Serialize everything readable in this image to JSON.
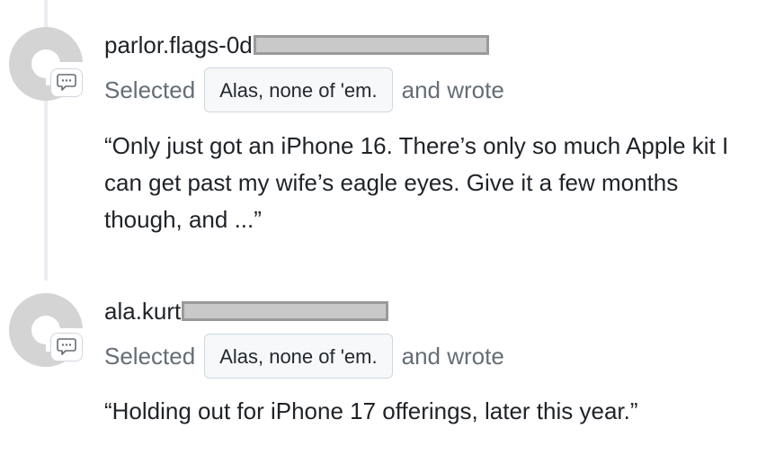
{
  "comments": [
    {
      "username": "parlor.flags-0d",
      "selected_label": "Selected",
      "choice": "Alas, none of 'em.",
      "wrote_label": "and wrote",
      "body": "“Only just got an iPhone 16. There’s only so much Apple kit I can get past my wife’s eagle eyes. Give it a few months though, and ...”",
      "avatar_icon": "default-avatar-icon",
      "badge_icon": "comment-bubble-icon"
    },
    {
      "username": "ala.kurt",
      "selected_label": "Selected",
      "choice": "Alas, none of 'em.",
      "wrote_label": "and wrote",
      "body": "“Holding out for iPhone 17 offerings, later this year.”",
      "avatar_icon": "default-avatar-icon",
      "badge_icon": "comment-bubble-icon"
    }
  ],
  "colors": {
    "muted_text": "#656d76",
    "primary_text": "#1f2328",
    "pill_background": "#f6f8fa",
    "border": "#d0d7de",
    "redaction_fill": "#c9c9c9",
    "redaction_border": "#9a9a9a"
  }
}
